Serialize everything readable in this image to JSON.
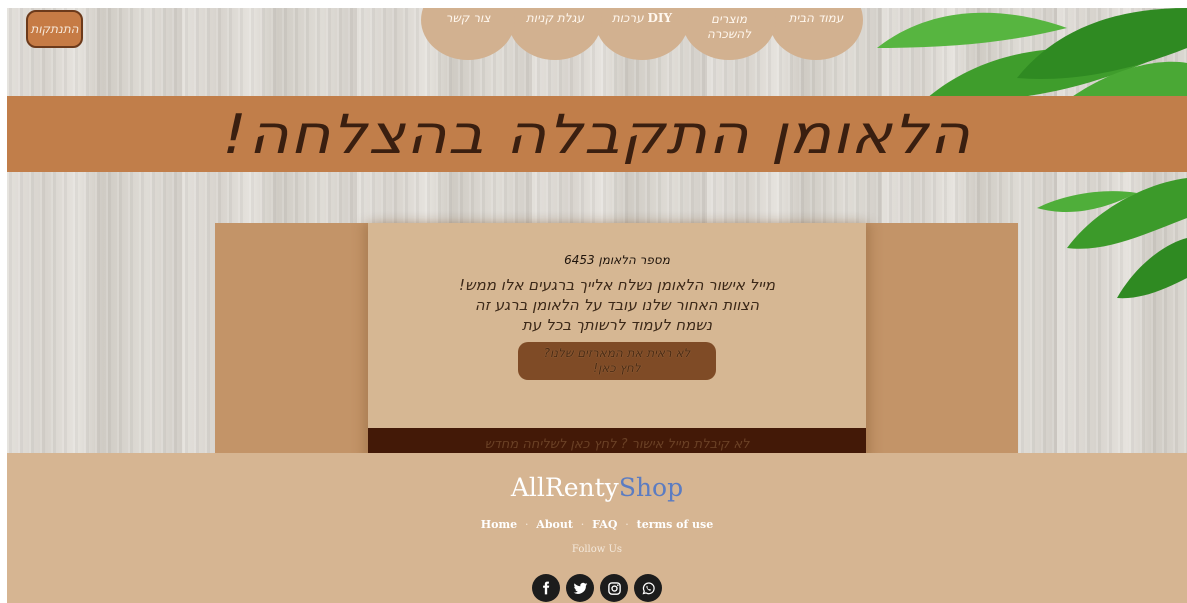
{
  "header": {
    "logout_label": "התנתקות",
    "nav": [
      {
        "label": "עמוד הבית"
      },
      {
        "label": "מוצרים להשכרה"
      },
      {
        "label": "ערכות",
        "label_suffix": "DIY"
      },
      {
        "label": "עגלת קניות"
      },
      {
        "label": "צור קשר"
      }
    ]
  },
  "banner": {
    "title": "הלאומן התקבלה בהצלחה!"
  },
  "order": {
    "number_label": "מספר הלאומן 6453",
    "message_lines": [
      "מייל אישור הלאומן נשלח אלייך ברגעים אלו ממש!",
      "הצוות האחור שלנו עובד על הלאומן ברגע זה",
      "נשמח לעמוד לרשותך בכל עת"
    ],
    "designers_button_lines": [
      "לא ראית את המארזים שלנו?",
      "לחץ כאן!"
    ],
    "resend_label": "לא קיבלת מייל אישור ? לחץ כאן לשליחה מחדש"
  },
  "footer": {
    "brand_part1": "AllRenty",
    "brand_part2": "Shop",
    "links": [
      "Home",
      "About",
      "FAQ",
      "terms of use"
    ],
    "separator": "·",
    "follow_label": "Follow Us",
    "socials": [
      {
        "icon": "facebook-icon"
      },
      {
        "icon": "twitter-icon"
      },
      {
        "icon": "instagram-icon"
      },
      {
        "icon": "whatsapp-icon"
      }
    ]
  },
  "colors": {
    "banner": "#c17e4a",
    "panel_outer": "#c39468",
    "panel_inner": "#d6b793",
    "resend_bar": "#431907",
    "footer": "#d6b592",
    "brand_blue": "#5b7cc2"
  }
}
